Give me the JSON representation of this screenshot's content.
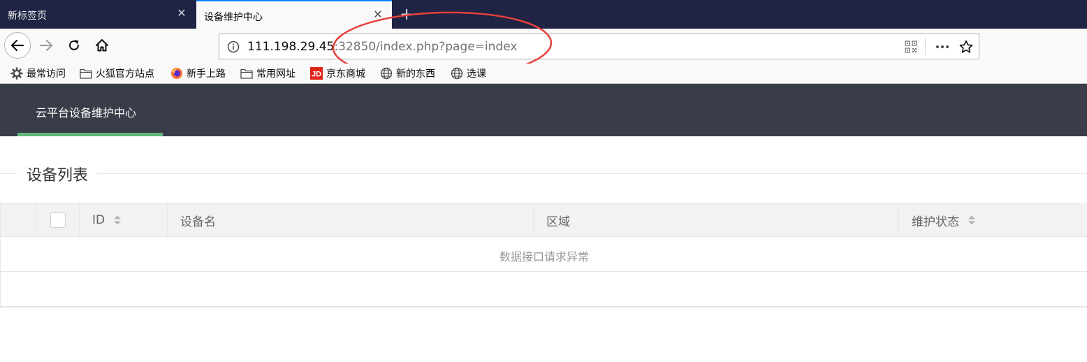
{
  "tabs": [
    {
      "title": "新标签页",
      "close": "✕"
    },
    {
      "title": "设备维护中心",
      "close": "✕"
    }
  ],
  "new_tab_label": "+",
  "url": {
    "host": "111.198.29.45",
    "rest": ":32850/index.php?page=index"
  },
  "bookmarks": [
    {
      "label": "最常访问",
      "icon": "gear-icon"
    },
    {
      "label": "火狐官方站点",
      "icon": "folder-icon"
    },
    {
      "label": "新手上路",
      "icon": "firefox-icon"
    },
    {
      "label": "常用网址",
      "icon": "folder-icon"
    },
    {
      "label": "京东商城",
      "icon": "jd-icon"
    },
    {
      "label": "新的东西",
      "icon": "globe-icon"
    },
    {
      "label": "选课",
      "icon": "globe-icon"
    }
  ],
  "app": {
    "title": "云平台设备维护中心",
    "accent_color": "#5fb878",
    "header_color": "#393d49"
  },
  "section": {
    "title": "设备列表"
  },
  "table": {
    "columns": {
      "id": "ID",
      "name": "设备名",
      "area": "区域",
      "status": "维护状态"
    },
    "empty_message": "数据接口请求异常"
  },
  "annotation_color": "#e8403a"
}
